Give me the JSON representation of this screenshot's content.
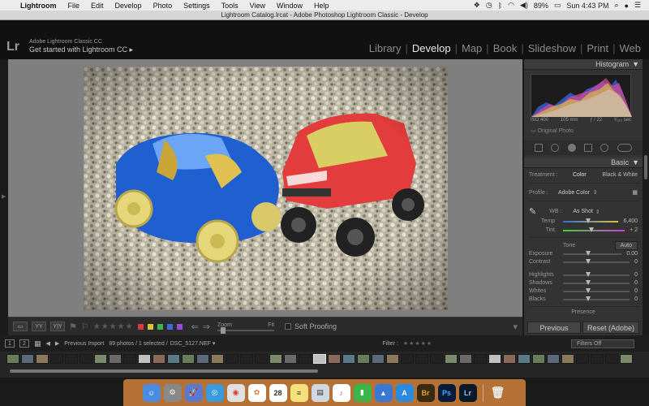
{
  "menubar": {
    "app": "Lightroom",
    "items": [
      "File",
      "Edit",
      "Develop",
      "Photo",
      "Settings",
      "Tools",
      "View",
      "Window",
      "Help"
    ],
    "battery": "89%",
    "clock": "Sun 4:43 PM"
  },
  "window": {
    "title": "Lightroom Catalog.lrcat - Adobe Photoshop Lightroom Classic - Develop"
  },
  "identity": {
    "logo": "Lr",
    "product": "Adobe Lightroom Classic CC",
    "tagline": "Get started with Lightroom CC ▸"
  },
  "modules": [
    "Library",
    "Develop",
    "Map",
    "Book",
    "Slideshow",
    "Print",
    "Web"
  ],
  "active_module": "Develop",
  "histogram": {
    "title": "Histogram",
    "iso": "ISO 400",
    "focal": "105 mm",
    "aperture": "ƒ / 22",
    "shutter": "¹⁄₁₆₀ sec",
    "original_photo": "Original Photo"
  },
  "basic": {
    "title": "Basic",
    "treatment_label": "Treatment :",
    "treatment_color": "Color",
    "treatment_bw": "Black & White",
    "profile_label": "Profile :",
    "profile_value": "Adobe Color",
    "wb_label": "WB :",
    "wb_value": "As Shot",
    "temp_label": "Temp",
    "temp_value": "6,400",
    "tint_label": "Tint",
    "tint_value": "+ 2",
    "tone_label": "Tone",
    "auto_label": "Auto",
    "exposure_label": "Exposure",
    "exposure_value": "0.00",
    "contrast_label": "Contrast",
    "contrast_value": "0",
    "highlights_label": "Highlights",
    "highlights_value": "0",
    "shadows_label": "Shadows",
    "shadows_value": "0",
    "whites_label": "Whites",
    "whites_value": "0",
    "blacks_label": "Blacks",
    "blacks_value": "0",
    "presence_label": "Presence"
  },
  "buttons": {
    "previous": "Previous",
    "reset": "Reset (Adobe)"
  },
  "toolbar": {
    "zoom": "Zoom",
    "fit": "Fit",
    "soft_proofing": "Soft Proofing"
  },
  "filmstrip": {
    "page1": "1",
    "page2": "2",
    "source": "Previous Import",
    "count": "89 photos / 1 selected /",
    "filename": "DSC_5127.NEF ▾",
    "filter_label": "Filter :",
    "filters_off": "Filters Off"
  },
  "colors": {
    "label_red": "#d63a3a",
    "label_yellow": "#d6c53a",
    "label_green": "#3ab54a",
    "label_blue": "#3a6ad6",
    "label_purple": "#9a4ad6"
  },
  "dock": [
    "Finder",
    "System Preferences",
    "Launchpad",
    "Safari",
    "Chrome",
    "Photos",
    "Calendar",
    "Notes",
    "Preview",
    "iTunes",
    "Numbers",
    "Keynote",
    "App Store",
    "Bridge",
    "Photoshop",
    "Lightroom",
    "Trash"
  ]
}
